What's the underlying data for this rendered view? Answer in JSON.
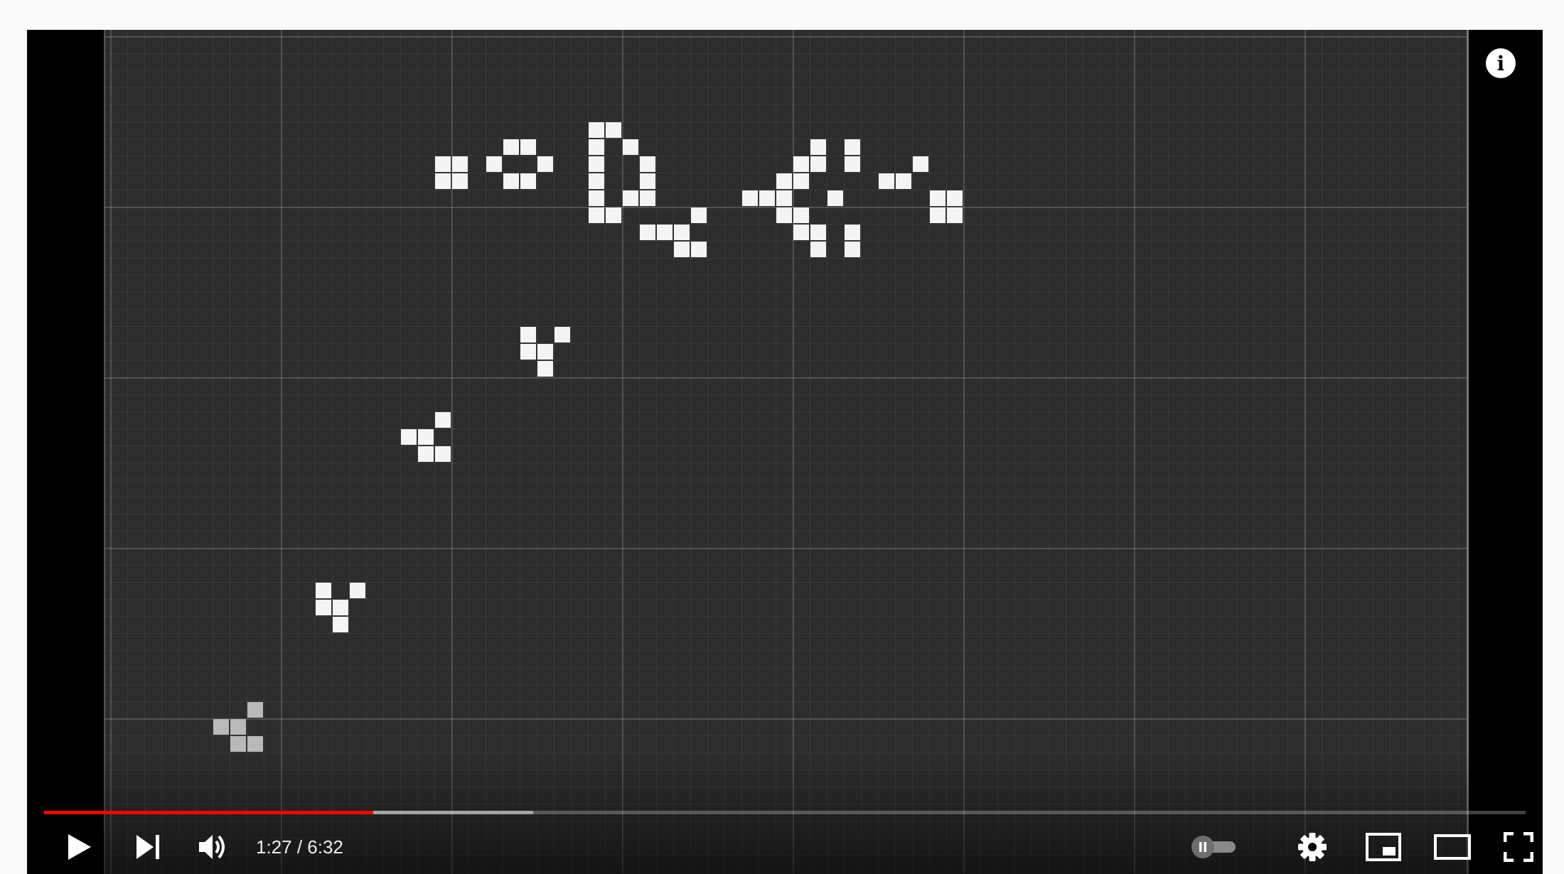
{
  "player": {
    "time": {
      "current": "1:27",
      "separator": " / ",
      "duration": "6:32"
    },
    "progress": {
      "played_fraction": 0.222,
      "buffered_fraction": 0.33
    },
    "icons": {
      "info": "info-icon",
      "play": "play-icon",
      "next": "next-icon",
      "volume": "volume-icon",
      "autoplay": "autoplay-toggle-icon",
      "settings": "settings-gear-icon",
      "miniplayer": "miniplayer-icon",
      "theater": "theater-mode-icon",
      "fullscreen": "fullscreen-icon"
    },
    "colors": {
      "progress_played": "#ff0000",
      "board_background": "#2d2d2d",
      "live_cell": "#f4f4f4"
    }
  },
  "board": {
    "description_type": "Game of Life grid",
    "live_cells": [
      [
        19,
        7
      ],
      [
        20,
        7
      ],
      [
        19,
        8
      ],
      [
        20,
        8
      ],
      [
        22,
        7
      ],
      [
        23,
        6
      ],
      [
        24,
        6
      ],
      [
        25,
        7
      ],
      [
        23,
        8
      ],
      [
        24,
        8
      ],
      [
        28,
        5
      ],
      [
        29,
        5
      ],
      [
        28,
        6
      ],
      [
        30,
        6
      ],
      [
        31,
        7
      ],
      [
        28,
        7
      ],
      [
        31,
        8
      ],
      [
        28,
        8
      ],
      [
        31,
        9
      ],
      [
        28,
        9
      ],
      [
        30,
        9
      ],
      [
        28,
        10
      ],
      [
        29,
        10
      ],
      [
        31,
        11
      ],
      [
        32,
        11
      ],
      [
        33,
        11
      ],
      [
        34,
        10
      ],
      [
        33,
        12
      ],
      [
        34,
        12
      ],
      [
        37,
        9
      ],
      [
        38,
        9
      ],
      [
        39,
        9
      ],
      [
        39,
        8
      ],
      [
        40,
        8
      ],
      [
        40,
        7
      ],
      [
        41,
        7
      ],
      [
        41,
        6
      ],
      [
        43,
        6
      ],
      [
        43,
        7
      ],
      [
        42,
        9
      ],
      [
        39,
        10
      ],
      [
        40,
        10
      ],
      [
        40,
        11
      ],
      [
        41,
        11
      ],
      [
        41,
        12
      ],
      [
        43,
        11
      ],
      [
        43,
        12
      ],
      [
        45,
        8
      ],
      [
        46,
        8
      ],
      [
        47,
        7
      ],
      [
        48,
        9
      ],
      [
        49,
        9
      ],
      [
        48,
        10
      ],
      [
        49,
        10
      ],
      [
        24,
        17
      ],
      [
        26,
        17
      ],
      [
        24,
        18
      ],
      [
        25,
        18
      ],
      [
        25,
        19
      ],
      [
        17,
        23
      ],
      [
        18,
        23
      ],
      [
        19,
        22
      ],
      [
        19,
        24
      ],
      [
        18,
        24
      ],
      [
        12,
        32
      ],
      [
        12,
        33
      ],
      [
        13,
        33
      ],
      [
        14,
        32
      ],
      [
        13,
        34
      ]
    ],
    "dim_cells": [
      [
        6,
        40
      ],
      [
        7,
        40
      ],
      [
        8,
        39
      ],
      [
        7,
        41
      ],
      [
        8,
        41
      ]
    ]
  }
}
